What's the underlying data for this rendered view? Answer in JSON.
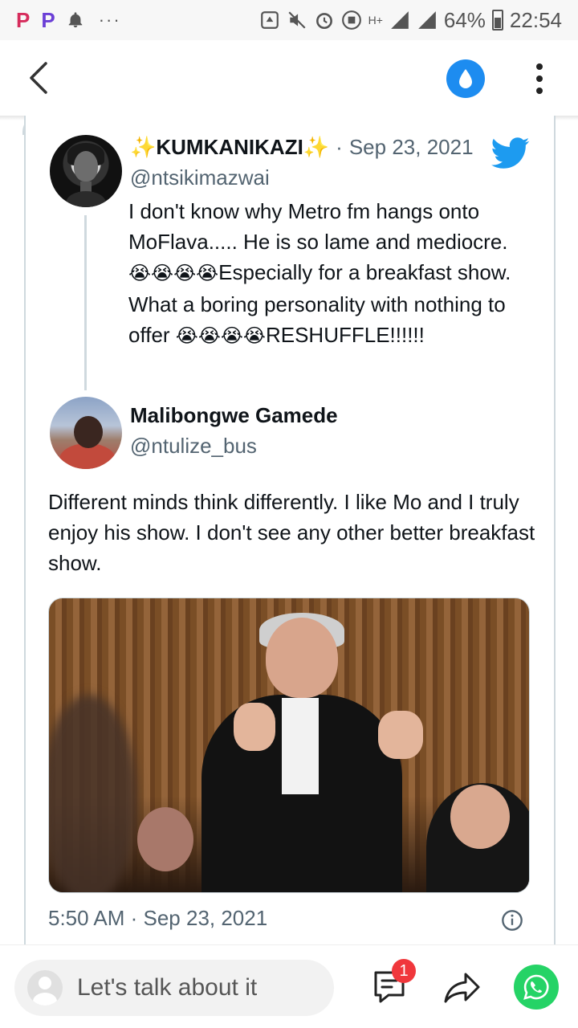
{
  "status_bar": {
    "left_icons": [
      "p-app-icon",
      "p-app-icon",
      "bell-icon"
    ],
    "more_indicator": "···",
    "network": "H+",
    "battery": "64%",
    "time": "22:54"
  },
  "app_bar": {
    "accent_color": "#1d8cf0"
  },
  "quoted_tweet": {
    "author_name": "KUMKANIKAZI",
    "author_sparkle": "✨",
    "date": "Sep 23, 2021",
    "handle": "@ntsikimazwai",
    "text_line1": "I don't know why Metro fm hangs onto MoFlava..... He is so lame and mediocre. ",
    "emoji_1": "😭😭😭😭",
    "text_line2": "Especially for a breakfast show.",
    "text_line3": "What a boring personality with nothing to offer ",
    "emoji_2": "😭😭😭😭",
    "text_line4": "RESHUFFLE!!!!!!"
  },
  "main_tweet": {
    "author_name": "Malibongwe Gamede",
    "handle": "@ntulize_bus",
    "text": "Different minds think differently. I like Mo and I truly enjoy his show. I don't see any other better breakfast show.",
    "timestamp": "5:50 AM · Sep 23, 2021"
  },
  "bottom_bar": {
    "comment_placeholder": "Let's talk about it",
    "comment_count": "1"
  },
  "colors": {
    "twitter_blue": "#1d9bf0",
    "whatsapp_green": "#25d366",
    "badge_red": "#f0373c"
  }
}
